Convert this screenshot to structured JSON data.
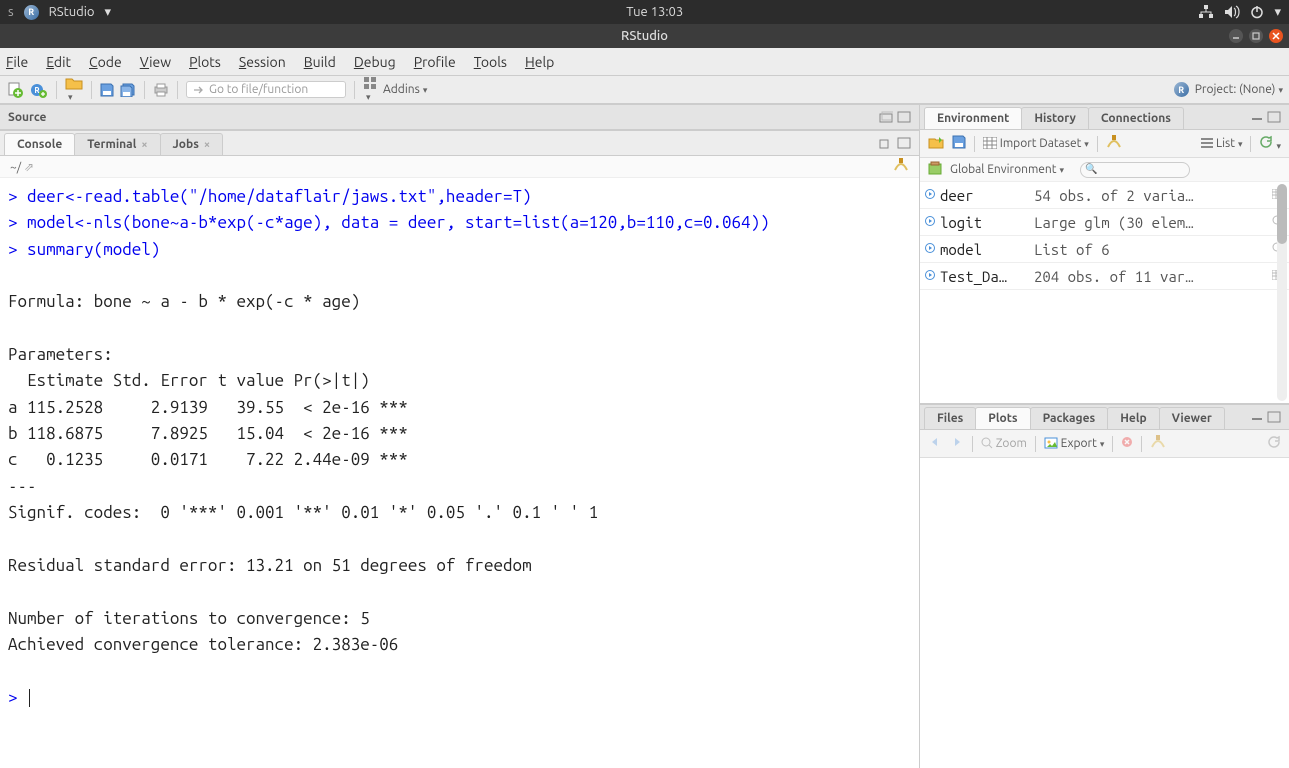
{
  "ubuntu": {
    "app": "RStudio",
    "clock": "Tue 13:03"
  },
  "window": {
    "title": "RStudio"
  },
  "menus": [
    "File",
    "Edit",
    "Code",
    "View",
    "Plots",
    "Session",
    "Build",
    "Debug",
    "Profile",
    "Tools",
    "Help"
  ],
  "toolbar": {
    "goto_placeholder": "Go to file/function",
    "addins": "Addins",
    "project_label": "Project: (None)"
  },
  "source_pane": {
    "title": "Source"
  },
  "console_tabs": {
    "console": "Console",
    "terminal": "Terminal",
    "jobs": "Jobs"
  },
  "console": {
    "wd": "~/",
    "lines": [
      {
        "type": "cmd",
        "text": "deer<-read.table(\"/home/dataflair/jaws.txt\",header=T)"
      },
      {
        "type": "cmd",
        "text": "model<-nls(bone~a-b*exp(-c*age), data = deer, start=list(a=120,b=110,c=0.064))"
      },
      {
        "type": "cmd",
        "text": "summary(model)"
      },
      {
        "type": "out",
        "text": ""
      },
      {
        "type": "out",
        "text": "Formula: bone ~ a - b * exp(-c * age)"
      },
      {
        "type": "out",
        "text": ""
      },
      {
        "type": "out",
        "text": "Parameters:"
      },
      {
        "type": "out",
        "text": "  Estimate Std. Error t value Pr(>|t|)    "
      },
      {
        "type": "out",
        "text": "a 115.2528     2.9139   39.55  < 2e-16 ***"
      },
      {
        "type": "out",
        "text": "b 118.6875     7.8925   15.04  < 2e-16 ***"
      },
      {
        "type": "out",
        "text": "c   0.1235     0.0171    7.22 2.44e-09 ***"
      },
      {
        "type": "out",
        "text": "---"
      },
      {
        "type": "out",
        "text": "Signif. codes:  0 '***' 0.001 '**' 0.01 '*' 0.05 '.' 0.1 ' ' 1"
      },
      {
        "type": "out",
        "text": ""
      },
      {
        "type": "out",
        "text": "Residual standard error: 13.21 on 51 degrees of freedom"
      },
      {
        "type": "out",
        "text": ""
      },
      {
        "type": "out",
        "text": "Number of iterations to convergence: 5 "
      },
      {
        "type": "out",
        "text": "Achieved convergence tolerance: 2.383e-06"
      },
      {
        "type": "out",
        "text": ""
      },
      {
        "type": "prompt",
        "text": ""
      }
    ]
  },
  "env_tabs": {
    "environment": "Environment",
    "history": "History",
    "connections": "Connections"
  },
  "env_toolbar": {
    "import": "Import Dataset",
    "list": "List"
  },
  "env_scope": "Global Environment",
  "env_items": [
    {
      "name": "deer",
      "desc": "54 obs. of 2 varia…",
      "icon": "grid"
    },
    {
      "name": "logit",
      "desc": "Large glm (30 elem…",
      "icon": "search"
    },
    {
      "name": "model",
      "desc": "List of 6",
      "icon": "search"
    },
    {
      "name": "Test_Da…",
      "desc": "204 obs. of 11 var…",
      "icon": "grid"
    }
  ],
  "plot_tabs": {
    "files": "Files",
    "plots": "Plots",
    "packages": "Packages",
    "help": "Help",
    "viewer": "Viewer"
  },
  "plot_toolbar": {
    "zoom": "Zoom",
    "export": "Export"
  }
}
